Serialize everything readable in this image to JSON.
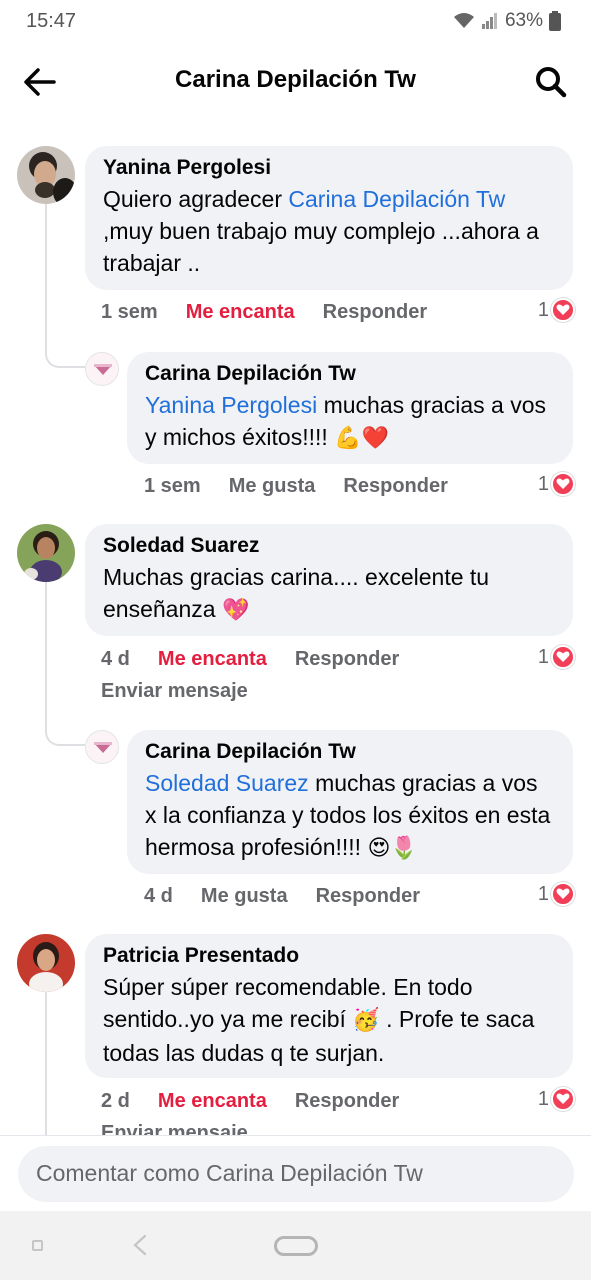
{
  "status_bar": {
    "time": "15:47",
    "battery": "63%"
  },
  "header": {
    "title": "Carina Depilación Tw"
  },
  "comments": [
    {
      "author": "Yanina Pergolesi",
      "text_before": "Quiero agradecer ",
      "mention": "Carina Depilación Tw",
      "text_after": " ,muy buen trabajo muy complejo ...ahora a trabajar ..",
      "time": "1 sem",
      "reaction_label": "Me encanta",
      "reply_label": "Responder",
      "reaction_count": "1",
      "reply": {
        "author": "Carina Depilación Tw",
        "mention": "Yanina Pergolesi",
        "text": " muchas gracias a vos y michos éxitos!!!! ",
        "emoji": "💪❤️",
        "time": "1 sem",
        "reaction_label": "Me gusta",
        "reply_label": "Responder",
        "reaction_count": "1"
      }
    },
    {
      "author": "Soledad Suarez",
      "text": "Muchas gracias carina.... excelente tu enseñanza ",
      "emoji": "💖",
      "time": "4 d",
      "reaction_label": "Me encanta",
      "reply_label": "Responder",
      "send_message_label": "Enviar mensaje",
      "reaction_count": "1",
      "reply": {
        "author": "Carina Depilación Tw",
        "mention": "Soledad Suarez",
        "text": " muchas gracias a vos x la confianza y todos los éxitos en esta hermosa profesión!!!! ",
        "emoji": "😍🌷",
        "time": "4 d",
        "reaction_label": "Me gusta",
        "reply_label": "Responder",
        "reaction_count": "1"
      }
    },
    {
      "author": "Patricia Presentado",
      "text_before": "Súper súper recomendable. En todo sentido..yo ya me recibí ",
      "emoji": "🥳",
      "text_after": " . Profe te saca todas las dudas q te surjan.",
      "time": "2 d",
      "reaction_label": "Me encanta",
      "reply_label": "Responder",
      "send_message_label": "Enviar mensaje",
      "reaction_count": "1"
    }
  ],
  "composer": {
    "placeholder": "Comentar como Carina Depilación Tw"
  },
  "colors": {
    "mention": "#216fdb",
    "love": "#e41e3f",
    "bubble": "#f0f2f5",
    "meta": "#65676b"
  }
}
